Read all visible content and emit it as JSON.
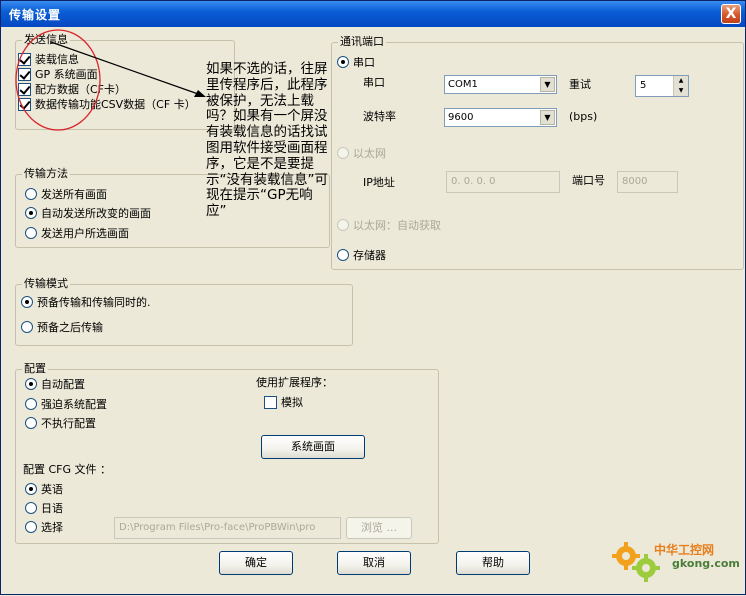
{
  "window": {
    "title": "传输设置",
    "close_label": "X"
  },
  "send_info": {
    "legend": "发送信息",
    "items": [
      {
        "label": "装载信息",
        "checked": true
      },
      {
        "label": "GP 系统画面",
        "checked": true
      },
      {
        "label": "配方数据（CF卡）",
        "checked": true
      },
      {
        "label": "数据传输功能CSV数据（CF 卡）",
        "checked": true
      }
    ]
  },
  "transfer_method": {
    "legend": "传输方法",
    "options": [
      "发送所有画面",
      "自动发送所改变的画面",
      "发送用户所选画面"
    ],
    "selected": 1
  },
  "transfer_mode": {
    "legend": "传输模式",
    "options": [
      "预备传输和传输同时的.",
      "预备之后传输"
    ],
    "selected": 0
  },
  "comm_port": {
    "legend": "通讯端口",
    "serial_label": "串口",
    "port_label": "串口",
    "port_value": "COM1",
    "retry_label": "重试",
    "retry_value": "5",
    "baud_label": "波特率",
    "baud_value": "9600",
    "baud_unit": "(bps)",
    "ethernet_label": "以太网",
    "ip_label": "IP地址",
    "ip_value": "0.  0.  0.  0",
    "port_no_label": "端口号",
    "port_no_value": "8000",
    "ethernet_auto_label": "以太网：自动获取",
    "storage_label": "存储器"
  },
  "config": {
    "legend": "配置",
    "options": [
      "自动配置",
      "强迫系统配置",
      "不执行配置"
    ],
    "selected": 0,
    "ext_label": "使用扩展程序：",
    "simulate_label": "模拟",
    "system_screen_button": "系统画面",
    "cfg_label": "配置 CFG 文件 ：",
    "cfg_options": [
      "英语",
      "日语",
      "选择"
    ],
    "cfg_selected": 0,
    "cfg_path": "D:\\Program Files\\Pro-face\\ProPBWin\\pro",
    "browse_button": "浏览 ..."
  },
  "buttons": {
    "ok": "确定",
    "cancel": "取消",
    "help": "帮助"
  },
  "annotation": {
    "text": "如果不选的话，往屏里传程序后，此程序被保护，无法上载吗？如果有一个屏没有装载信息的话找试图用软件接受画面程序，它是不是要提示“没有装载信息”可现在提示“GP无响应”"
  },
  "watermark": {
    "line1": "中华工控网",
    "line2": "gkong.com"
  },
  "colors": {
    "title_bar": "#0a5fd6",
    "dialog_bg": "#ece9d8",
    "annotation_circle": "#d9262c",
    "annotation_arrow": "#000000"
  }
}
